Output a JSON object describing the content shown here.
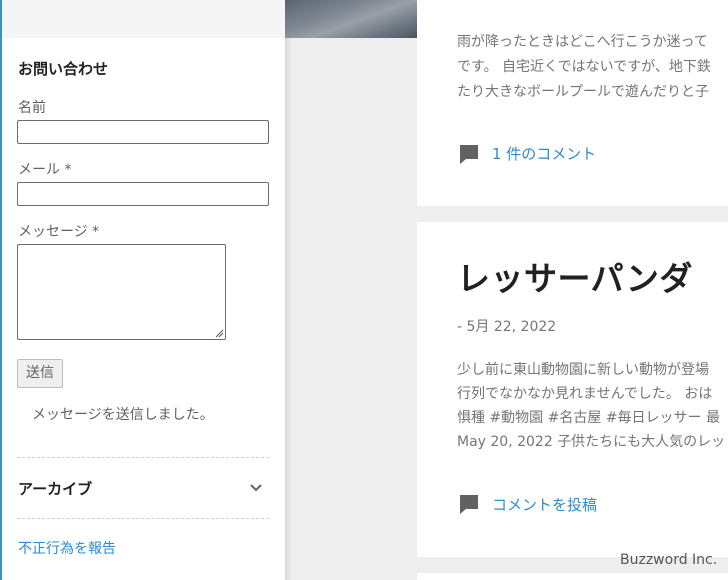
{
  "contact": {
    "title": "お問い合わせ",
    "name_label": "名前",
    "name_value": "",
    "email_label": "メール *",
    "email_value": "",
    "message_label": "メッセージ *",
    "message_value": "",
    "submit_label": "送信",
    "sent_text": "メッセージを送信しました。"
  },
  "archive": {
    "title": "アーカイブ"
  },
  "report_link": "不正行為を報告",
  "posts": [
    {
      "excerpt_lines": [
        " 雨が降ったときはどこへ行こうか迷って",
        "です。 自宅近くではないですが、地下鉄",
        "たり大きなボールプールで遊んだりと子"
      ],
      "comment_link": "1 件のコメント"
    },
    {
      "title": "レッサーパンダ",
      "date": "- 5月 22, 2022",
      "excerpt_lines": [
        "少し前に東山動物園に新しい動物が登場",
        "行列でなかなか見れませんでした。 おは",
        "惧種 #動物園 #名古屋 #毎日レッサー 最",
        "May 20, 2022 子供たちにも大人気のレッ"
      ],
      "comment_link": "コメントを投稿"
    }
  ],
  "watermark": "Buzzword Inc.",
  "colors": {
    "link": "#2e8bd0",
    "background": "#eeeeee",
    "card": "#ffffff"
  }
}
